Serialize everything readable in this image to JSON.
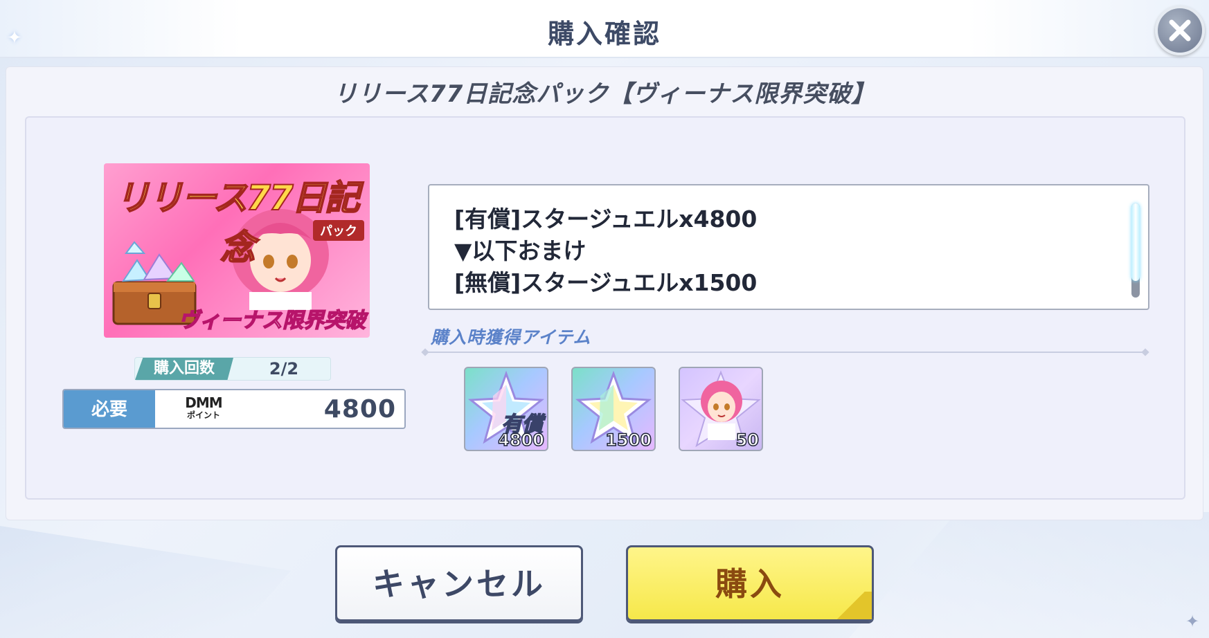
{
  "header": {
    "title": "購入確認",
    "close_icon": "close-icon"
  },
  "pack": {
    "name": "リリース77日記念パック【ヴィーナス限界突破】",
    "banner": {
      "title": "リリース77日記念",
      "badge": "パック",
      "subtitle": "ヴィーナス限界突破"
    }
  },
  "purchase_count": {
    "label": "購入回数",
    "value": "2/2"
  },
  "required": {
    "label": "必要",
    "currency_line1": "DMM",
    "currency_line2": "ポイント",
    "value": "4800"
  },
  "description": {
    "lines": [
      "[有償]スタージュエルx4800",
      "▼以下おまけ",
      "[無償]スタージュエルx1500"
    ],
    "scroll_fraction_visible": 0.82
  },
  "items": {
    "title": "購入時獲得アイテム",
    "list": [
      {
        "icon": "star-jewel-icon",
        "tag": "有償",
        "quantity": "4800"
      },
      {
        "icon": "star-jewel-icon",
        "tag": "",
        "quantity": "1500"
      },
      {
        "icon": "character-piece-icon",
        "tag": "",
        "quantity": "50"
      }
    ]
  },
  "buttons": {
    "cancel": "キャンセル",
    "buy": "購入"
  },
  "colors": {
    "buy_button": "#f6e84a",
    "required_label": "#5a9bd0",
    "count_label": "#5aa6a8",
    "items_title": "#5b82c9"
  }
}
